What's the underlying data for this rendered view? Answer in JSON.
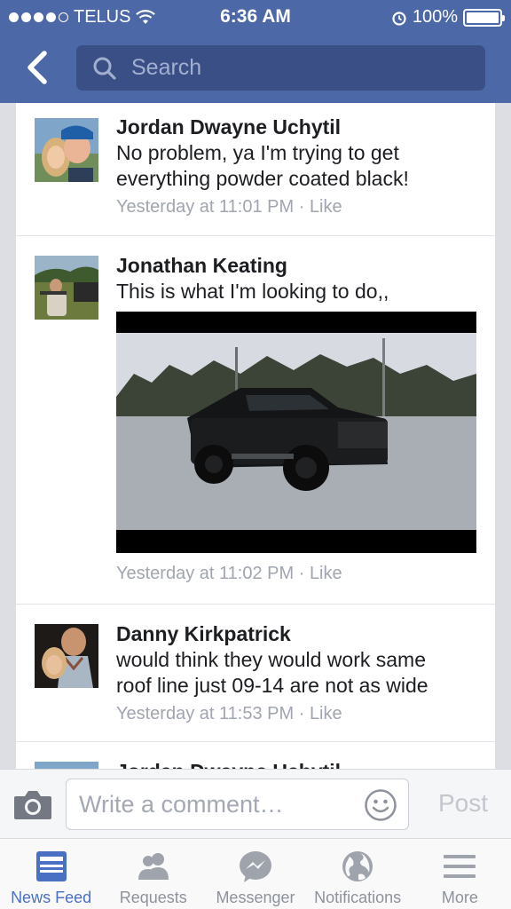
{
  "status_bar": {
    "carrier": "TELUS",
    "time": "6:36 AM",
    "battery": "100%"
  },
  "nav": {
    "search_placeholder": "Search"
  },
  "comments": [
    {
      "name": "Jordan Dwayne Uchytil",
      "text_lines": [
        "No problem, ya I'm trying to get",
        "everything powder coated black!"
      ],
      "timestamp": "Yesterday at 11:01 PM",
      "separator": "·",
      "like": "Like"
    },
    {
      "name": "Jonathan Keating",
      "text_lines": [
        "This is what I'm looking to do,,"
      ],
      "timestamp": "Yesterday at 11:02 PM",
      "separator": "·",
      "like": "Like",
      "has_photo": true
    },
    {
      "name": "Danny Kirkpatrick",
      "text_lines": [
        "would think they would work same",
        "roof line just 09-14 are not as wide"
      ],
      "timestamp": "Yesterday at 11:53 PM",
      "separator": "·",
      "like": "Like"
    },
    {
      "name": "Jordan Dwayne Uchytil"
    }
  ],
  "composer": {
    "placeholder": "Write a comment…",
    "post_label": "Post"
  },
  "tabs": [
    {
      "label": "News Feed",
      "icon": "news-feed-icon",
      "active": true
    },
    {
      "label": "Requests",
      "icon": "requests-icon",
      "active": false
    },
    {
      "label": "Messenger",
      "icon": "messenger-icon",
      "active": false
    },
    {
      "label": "Notifications",
      "icon": "globe-icon",
      "active": false
    },
    {
      "label": "More",
      "icon": "menu-icon",
      "active": false
    }
  ],
  "colors": {
    "nav_blue": "#4c68a6",
    "search_bg": "#3a4f86",
    "active_tab": "#4a70c3",
    "inactive_tab": "#8d929b"
  }
}
